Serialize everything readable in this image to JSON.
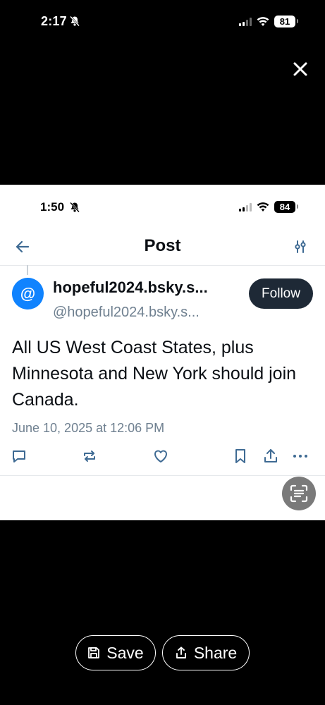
{
  "outer_status_bar": {
    "time": "2:17",
    "battery": "81"
  },
  "inner_status_bar": {
    "time": "1:50",
    "battery": "84"
  },
  "header": {
    "title": "Post"
  },
  "post": {
    "avatar_symbol": "@",
    "display_name": "hopeful2024.bsky.s...",
    "handle": "@hopeful2024.bsky.s...",
    "follow_label": "Follow",
    "text": "All US West Coast States, plus Minnesota and New York should join Canada.",
    "timestamp": "June 10, 2025 at 12:06 PM"
  },
  "actions": [
    "reply-icon",
    "repost-icon",
    "like-icon",
    "bookmark-icon",
    "share-icon",
    "more-icon"
  ],
  "bottom_buttons": {
    "save_label": "Save",
    "share_label": "Share"
  },
  "colors": {
    "accent": "#1083fe",
    "follow_bg": "#1e2936",
    "muted_text": "#6f8090"
  }
}
